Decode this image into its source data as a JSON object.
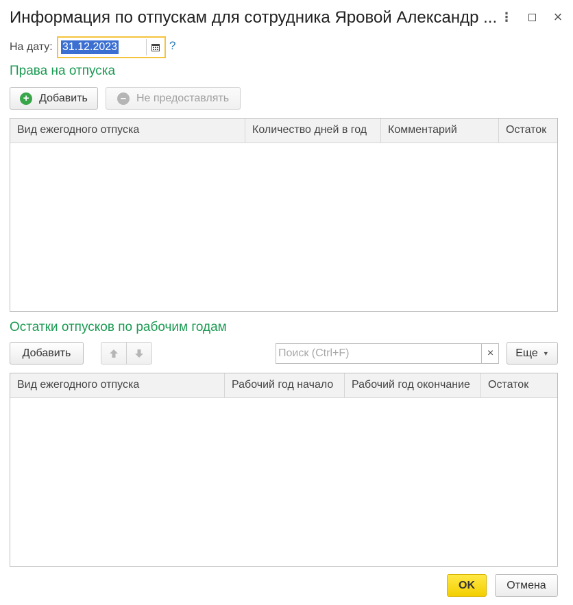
{
  "window": {
    "title": "Информация по отпускам для сотрудника Яровой Александр ...",
    "more_icon": "more-vertical-icon",
    "maximize_icon": "maximize-icon",
    "close_icon": "close-icon"
  },
  "date": {
    "label": "На дату:",
    "value": "31.12.2023",
    "calendar_icon": "calendar-icon",
    "help": "?"
  },
  "rights": {
    "title": "Права на отпуска",
    "add_button": "Добавить",
    "not_grant_button": "Не предоставлять",
    "columns": [
      "Вид ежегодного отпуска",
      "Количество дней в год",
      "Комментарий",
      "Остаток"
    ],
    "rows": []
  },
  "balances": {
    "title": "Остатки отпусков по рабочим годам",
    "add_button": "Добавить",
    "up_icon": "arrow-up-icon",
    "down_icon": "arrow-down-icon",
    "search_placeholder": "Поиск (Ctrl+F)",
    "search_clear": "×",
    "more_button": "Еще",
    "columns": [
      "Вид ежегодного отпуска",
      "Рабочий год начало",
      "Рабочий год окончание",
      "Остаток"
    ],
    "rows": []
  },
  "footer": {
    "ok_button": "OK",
    "cancel_button": "Отмена"
  },
  "colors": {
    "accent_green": "#1a9a52",
    "ok_yellow": "#f5d400",
    "focus_border": "#f5c43b",
    "selection_blue": "#3b6fd1"
  }
}
